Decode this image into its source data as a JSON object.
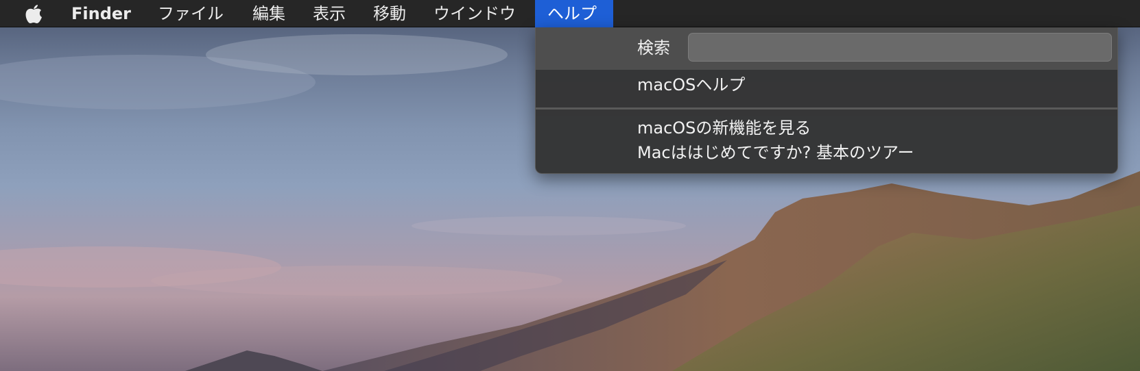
{
  "menubar": {
    "app_name": "Finder",
    "items": [
      "ファイル",
      "編集",
      "表示",
      "移動",
      "ウインドウ",
      "ヘルプ"
    ],
    "active_item": "ヘルプ"
  },
  "help_menu": {
    "search_label": "検索",
    "search_value": "",
    "items": [
      "macOSヘルプ",
      "macOSの新機能を見る",
      "Macははじめてですか? 基本のツアー"
    ]
  },
  "colors": {
    "menubar_bg": "#262626",
    "active_highlight": "#1e5fd6",
    "dropdown_bg": "#343434"
  }
}
